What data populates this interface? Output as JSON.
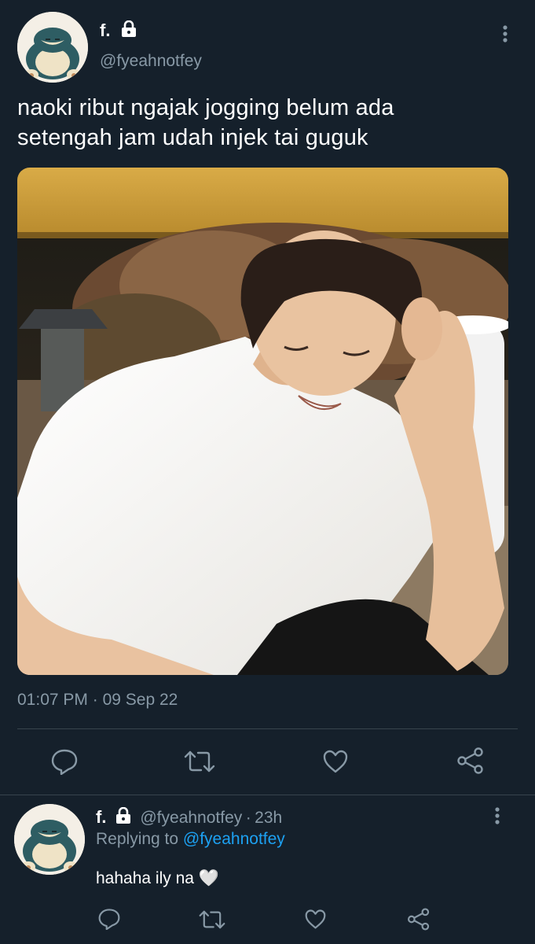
{
  "tweet": {
    "display_name": "f.",
    "handle": "@fyeahnotfey",
    "text_line1": "naoki ribut ngajak jogging belum ada",
    "text_line2": "setengah jam udah injek tai guguk",
    "time": "01:07 PM",
    "separator": "·",
    "date": "09 Sep 22"
  },
  "reply": {
    "display_name": "f.",
    "handle": "@fyeahnotfey",
    "separator": "·",
    "age": "23h",
    "replying_prefix": "Replying to",
    "replying_handle": "@fyeahnotfey",
    "text": "hahaha ily na 🤍"
  },
  "icons": [
    "lock-icon",
    "more-icon",
    "reply-icon",
    "retweet-icon",
    "like-icon",
    "share-icon"
  ],
  "colors": {
    "background": "#15202b",
    "secondary_text": "#8899a6",
    "link": "#1da1f2",
    "divider": "#38444d"
  }
}
